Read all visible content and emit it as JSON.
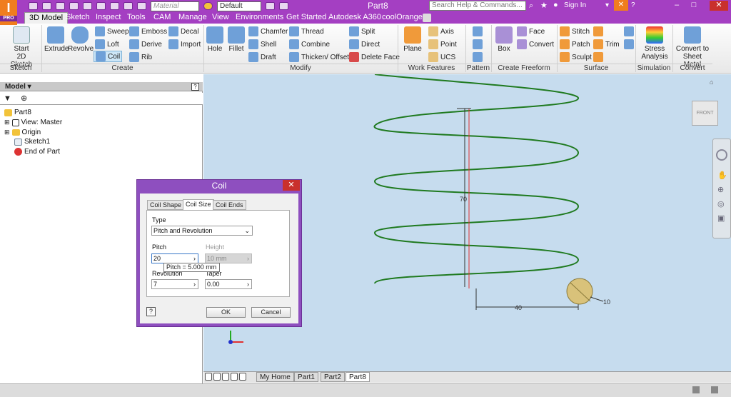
{
  "app": {
    "logo": "I",
    "logo_sub": "PRO",
    "doc_title": "Part8",
    "search_placeholder": "Search Help & Commands...",
    "sign_in": "Sign In"
  },
  "quick_access": {
    "material": "Material",
    "appearance": "Default"
  },
  "tabs": [
    "3D Model",
    "Sketch",
    "Inspect",
    "Tools",
    "CAM",
    "Manage",
    "View",
    "Environments",
    "Get Started",
    "Autodesk A360",
    "coolOrange"
  ],
  "ribbon": {
    "sketch": {
      "label": "Sketch",
      "start": "Start",
      "start2": "2D Sketch"
    },
    "create": {
      "label": "Create",
      "extrude": "Extrude",
      "revolve": "Revolve",
      "sweep": "Sweep",
      "loft": "Loft",
      "coil": "Coil",
      "emboss": "Emboss",
      "derive": "Derive",
      "rib": "Rib",
      "decal": "Decal",
      "import": "Import"
    },
    "modify": {
      "label": "Modify",
      "hole": "Hole",
      "fillet": "Fillet",
      "chamfer": "Chamfer",
      "shell": "Shell",
      "draft": "Draft",
      "thread": "Thread",
      "combine": "Combine",
      "thicken": "Thicken/ Offset",
      "split": "Split",
      "direct": "Direct",
      "delete_face": "Delete Face"
    },
    "work": {
      "label": "Work Features",
      "plane": "Plane",
      "axis": "Axis",
      "point": "Point",
      "ucs": "UCS"
    },
    "pattern": {
      "label": "Pattern"
    },
    "freeform": {
      "label": "Create Freeform",
      "box": "Box",
      "face": "Face",
      "convert": "Convert"
    },
    "surface": {
      "label": "Surface",
      "stitch": "Stitch",
      "patch": "Patch",
      "sculpt": "Sculpt",
      "trim": "Trim"
    },
    "simulation": {
      "label": "Simulation",
      "stress": "Stress",
      "stress2": "Analysis"
    },
    "convert": {
      "label": "Convert",
      "sheet": "Convert to",
      "sheet2": "Sheet Metal"
    }
  },
  "browser": {
    "title": "Model",
    "items": [
      "Part8",
      "View: Master",
      "Origin",
      "Sketch1",
      "End of Part"
    ]
  },
  "viewcube": {
    "label": "FRONT"
  },
  "dimensions": {
    "height": "70",
    "width": "40",
    "diameter": "10"
  },
  "dialog": {
    "title": "Coil",
    "close": "✕",
    "tabs": [
      "Coil Shape",
      "Coil Size",
      "Coil Ends"
    ],
    "type_label": "Type",
    "type_value": "Pitch and Revolution",
    "pitch_label": "Pitch",
    "pitch_value": "20",
    "height_label": "Height",
    "height_value": "10 mm",
    "tooltip": "Pitch = 5.000 mm",
    "revolution_label": "Revolution",
    "revolution_value": "7",
    "taper_label": "Taper",
    "taper_value": "0.00",
    "ok": "OK",
    "cancel": "Cancel",
    "help": "?"
  },
  "doc_tabs": [
    "My Home",
    "Part1",
    "Part2",
    "Part8"
  ],
  "colors": {
    "titlebar": "#a43fc2",
    "viewport": "#c6dcee",
    "coil": "#1f7a1f",
    "dialog": "#8e4fbf"
  }
}
